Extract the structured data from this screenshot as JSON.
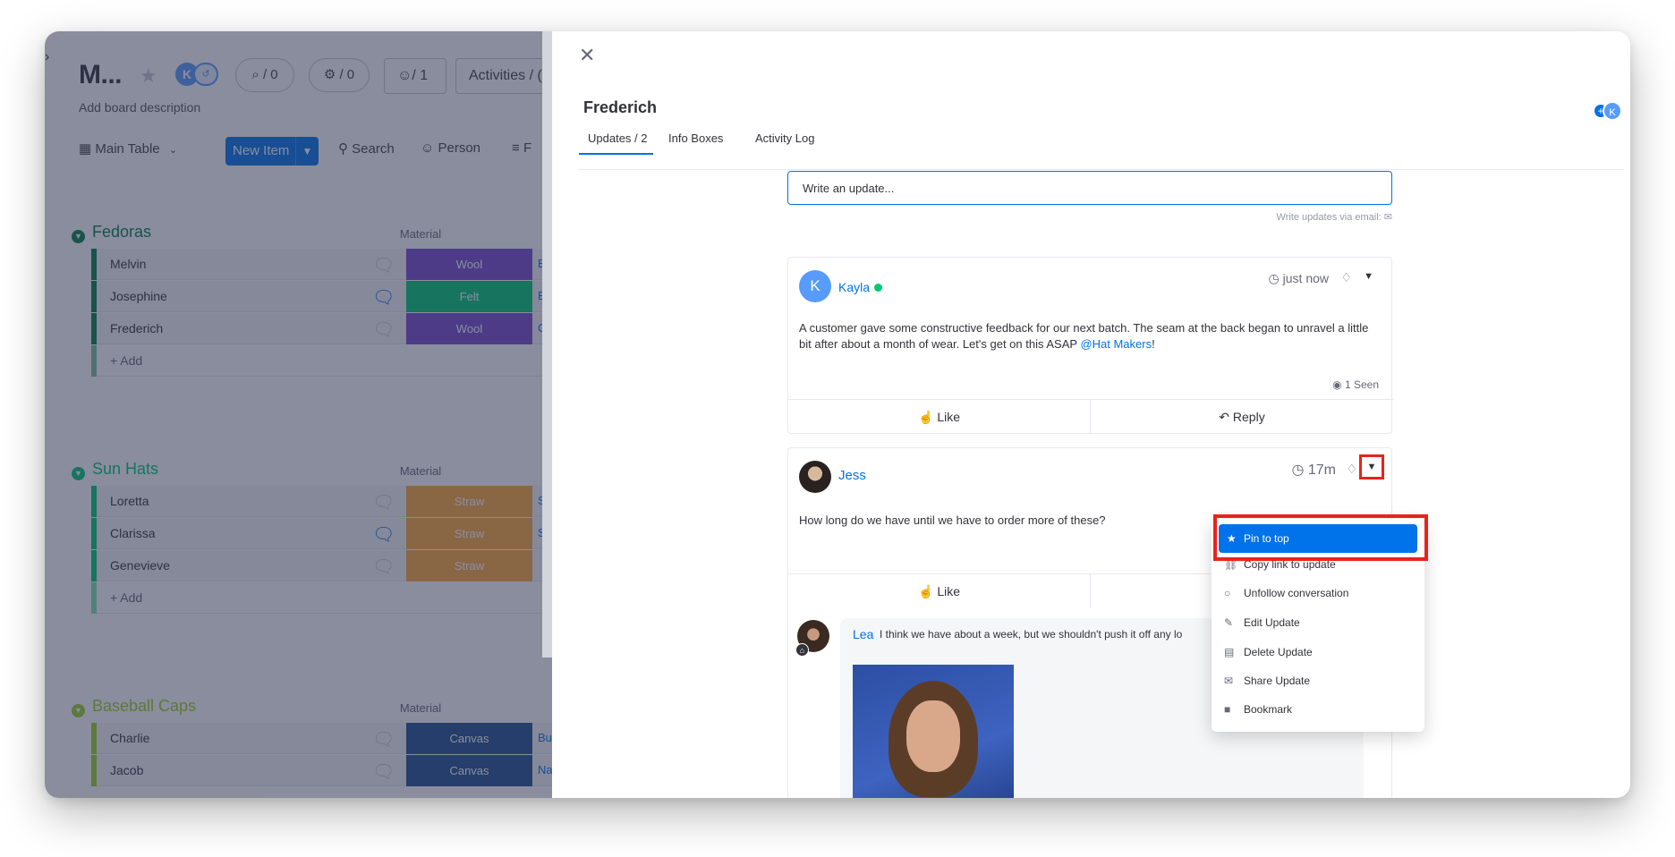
{
  "board": {
    "title": "M...",
    "description": "Add board description",
    "pill1": "⌕ / 0",
    "pill2": "⚙ / 0",
    "members_btn": "☺/ 1",
    "activities_btn": "Activities / (",
    "toolbar": {
      "table_label": "Main Table",
      "new_item": "New Item",
      "search": "Search",
      "person": "Person",
      "filter": "F"
    },
    "groups": [
      {
        "name": "Fedoras",
        "color": "#037f4c",
        "column_header": "Material",
        "rows": [
          {
            "name": "Melvin",
            "material": "Wool",
            "material_color": "#784bd1",
            "color_text": "Burgu..."
          },
          {
            "name": "Josephine",
            "material": "Felt",
            "material_color": "#00c875",
            "color_text": "Blac"
          },
          {
            "name": "Frederich",
            "material": "Wool",
            "material_color": "#784bd1",
            "color_text": "Charco"
          }
        ],
        "add_label": "+ Add"
      },
      {
        "name": "Sun Hats",
        "color": "#00c875",
        "column_header": "Material",
        "rows": [
          {
            "name": "Loretta",
            "material": "Straw",
            "material_color": "#fdab3d",
            "color_text": "St"
          },
          {
            "name": "Clarissa",
            "material": "Straw",
            "material_color": "#fdab3d",
            "color_text": "St"
          },
          {
            "name": "Genevieve",
            "material": "Straw",
            "material_color": "#fdab3d",
            "color_text": ""
          }
        ],
        "add_label": "+ Add"
      },
      {
        "name": "Baseball Caps",
        "color": "#9cd326",
        "column_header": "Material",
        "rows": [
          {
            "name": "Charlie",
            "material": "Canvas",
            "material_color": "#225091",
            "color_text": "Burgu"
          },
          {
            "name": "Jacob",
            "material": "Canvas",
            "material_color": "#225091",
            "color_text": "Nav"
          }
        ]
      }
    ]
  },
  "panel": {
    "item_title": "Frederich",
    "tabs": [
      "Updates / 2",
      "Info Boxes",
      "Activity Log"
    ],
    "update_placeholder": "Write an update...",
    "via_email": "Write updates via email: ✉",
    "posts": [
      {
        "author": "Kayla",
        "avatar_letter": "K",
        "time": "just now",
        "body": "A customer gave some constructive feedback for our next batch. The seam at the back began to unravel a little bit after about a month of wear. Let's get on this ASAP ",
        "mention": "@Hat Makers",
        "body_end": "!",
        "seen": "1 Seen",
        "like": "Like",
        "reply": "Reply"
      },
      {
        "author": "Jess",
        "time": "17m",
        "body": "How long do we have until we have to order more of these?",
        "like": "Like",
        "reply_author": "Lea",
        "reply_text": "I think we have about a week, but we shouldn't push it off any lo"
      }
    ],
    "menu": [
      {
        "label": "Pin to top",
        "icon": "★"
      },
      {
        "label": "Copy link to update",
        "icon": "⛓"
      },
      {
        "label": "Unfollow conversation",
        "icon": "○"
      },
      {
        "label": "Edit Update",
        "icon": "✎"
      },
      {
        "label": "Delete Update",
        "icon": "▤"
      },
      {
        "label": "Share Update",
        "icon": "✉"
      },
      {
        "label": "Bookmark",
        "icon": "■"
      }
    ]
  }
}
